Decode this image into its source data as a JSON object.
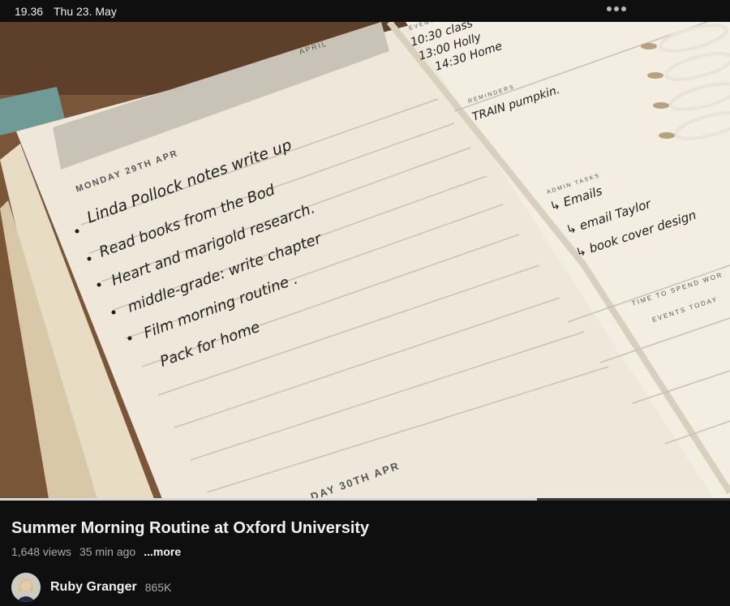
{
  "status_bar": {
    "time": "19.36",
    "date": "Thu 23. May",
    "more_icon": "more-dots-icon"
  },
  "video": {
    "progress_fraction": 0.735,
    "planner": {
      "month_tab": "APRIL",
      "day_header": "MONDAY 29TH APR",
      "next_day_header": "DAY 30TH APR",
      "tasks": [
        "Linda Pollock notes write up",
        "Read books from the Bod",
        "Heart and marigold research.",
        "middle-grade: write chapter",
        "Film morning routine .",
        "Pack for home"
      ],
      "events_label": "EVENTS",
      "events": [
        "10:30 class",
        "13:00 Holly",
        "14:30 Home"
      ],
      "reminders_label": "REMINDERS",
      "reminder": "TRAIN pumpkin.",
      "admin_label": "ADMIN TASKS",
      "admin_tasks": [
        "↳ Emails",
        "↳ email Taylor",
        "↳ book cover design"
      ],
      "time_label": "TIME TO SPEND WOR",
      "events_today_label": "EVENTS TODAY"
    }
  },
  "title": "Summer Morning Routine at Oxford University",
  "views": "1,648 views",
  "age": "35 min ago",
  "more_label": "...more",
  "channel": {
    "name": "Ruby Granger",
    "subscribers": "865K"
  }
}
